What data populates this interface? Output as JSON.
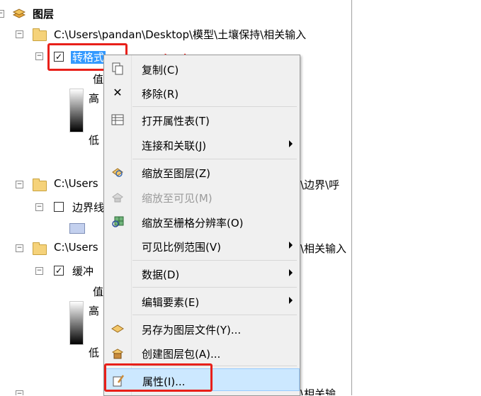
{
  "toc": {
    "root_label": "图层",
    "groups": [
      {
        "path": "C:\\Users\\pandan\\Desktop\\模型\\土壤保持\\相关输入",
        "layer": "转格式",
        "value_label": "值",
        "high": "高",
        "low": "低"
      },
      {
        "path": "C:\\Users",
        "path_tail": "\\边界\\呼",
        "layer": "边界线"
      },
      {
        "path": "C:\\Users",
        "path_tail": "\\相关输入",
        "layer": "缓冲",
        "value_label": "值",
        "high": "高",
        "low": "低"
      },
      {
        "path": "C:\\Users",
        "path_tail": "\\相关输"
      }
    ]
  },
  "annotation": {
    "text": "右击",
    "color": "#e8201a"
  },
  "menu": {
    "items": [
      {
        "label": "复制(C)",
        "icon": "copy-icon",
        "enabled": true
      },
      {
        "label": "移除(R)",
        "icon": "remove-x-icon",
        "enabled": true
      },
      {
        "label": "打开属性表(T)",
        "icon": "table-icon",
        "enabled": true
      },
      {
        "label": "连接和关联(J)",
        "icon": "",
        "enabled": true,
        "submenu": true
      },
      {
        "label": "缩放至图层(Z)",
        "icon": "zoom-layer-icon",
        "enabled": true
      },
      {
        "label": "缩放至可见(M)",
        "icon": "zoom-visible-icon",
        "enabled": false
      },
      {
        "label": "缩放至栅格分辨率(O)",
        "icon": "raster-resolution-icon",
        "enabled": true
      },
      {
        "label": "可见比例范围(V)",
        "icon": "",
        "enabled": true,
        "submenu": true
      },
      {
        "label": "数据(D)",
        "icon": "",
        "enabled": true,
        "submenu": true
      },
      {
        "label": "编辑要素(E)",
        "icon": "",
        "enabled": true,
        "submenu": true
      },
      {
        "label": "另存为图层文件(Y)...",
        "icon": "save-layer-icon",
        "enabled": true
      },
      {
        "label": "创建图层包(A)...",
        "icon": "layer-package-icon",
        "enabled": true
      },
      {
        "label": "属性(I)...",
        "icon": "properties-icon",
        "enabled": true,
        "highlighted": true
      }
    ]
  }
}
